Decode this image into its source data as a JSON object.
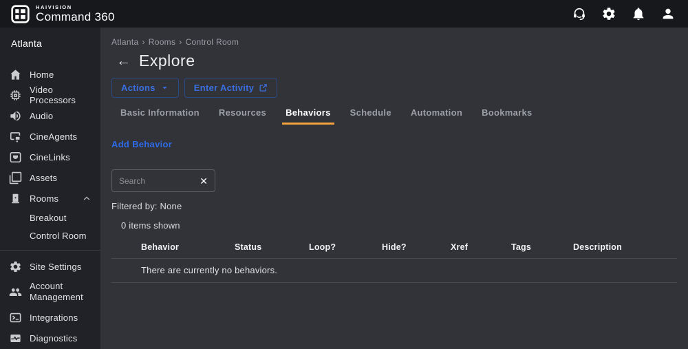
{
  "topbar": {
    "brand_small": "HAIVISION",
    "brand_large": "Command 360",
    "icons": [
      {
        "name": "support-headset"
      },
      {
        "name": "settings-gear"
      },
      {
        "name": "notifications-bell"
      },
      {
        "name": "user-account"
      }
    ]
  },
  "sidebar": {
    "site_name": "Atlanta",
    "items": [
      {
        "label": "Home"
      },
      {
        "label": "Video Processors"
      },
      {
        "label": "Audio"
      },
      {
        "label": "CineAgents"
      },
      {
        "label": "CineLinks"
      },
      {
        "label": "Assets"
      },
      {
        "label": "Rooms",
        "expanded": true
      },
      {
        "label": "Breakout"
      },
      {
        "label": "Control Room"
      },
      {
        "label": "Site Settings"
      },
      {
        "label": "Account Management"
      },
      {
        "label": "Integrations"
      },
      {
        "label": "Diagnostics"
      }
    ]
  },
  "main": {
    "breadcrumb": {
      "parts": [
        "Atlanta",
        "Rooms",
        "Control Room"
      ],
      "separator": "›"
    },
    "back_arrow": "←",
    "title": "Explore",
    "buttons": {
      "actions": "Actions",
      "enter_activity": "Enter Activity"
    },
    "tabs": [
      {
        "label": "Basic Information",
        "active": false
      },
      {
        "label": "Resources",
        "active": false
      },
      {
        "label": "Behaviors",
        "active": true
      },
      {
        "label": "Schedule",
        "active": false
      },
      {
        "label": "Automation",
        "active": false
      },
      {
        "label": "Bookmarks",
        "active": false
      }
    ],
    "add_behavior_link": "Add Behavior",
    "search": {
      "placeholder": "Search",
      "value": "",
      "clear_glyph": "✕"
    },
    "filtered_by": "Filtered by: None",
    "items_shown": "0 items shown",
    "table": {
      "headers": [
        "Behavior",
        "Status",
        "Loop?",
        "Hide?",
        "Xref",
        "Tags",
        "Description"
      ],
      "empty_message": "There are currently no behaviors."
    }
  },
  "colors": {
    "topbar_bg": "#17181c",
    "sidebar_bg": "#212227",
    "content_bg": "#313339",
    "accent_blue": "#3a6fe0",
    "link_blue": "#2f6be8",
    "tab_underline_orange": "#f0a23c",
    "muted_text": "#9ba0a6",
    "divider": "#474a51"
  }
}
